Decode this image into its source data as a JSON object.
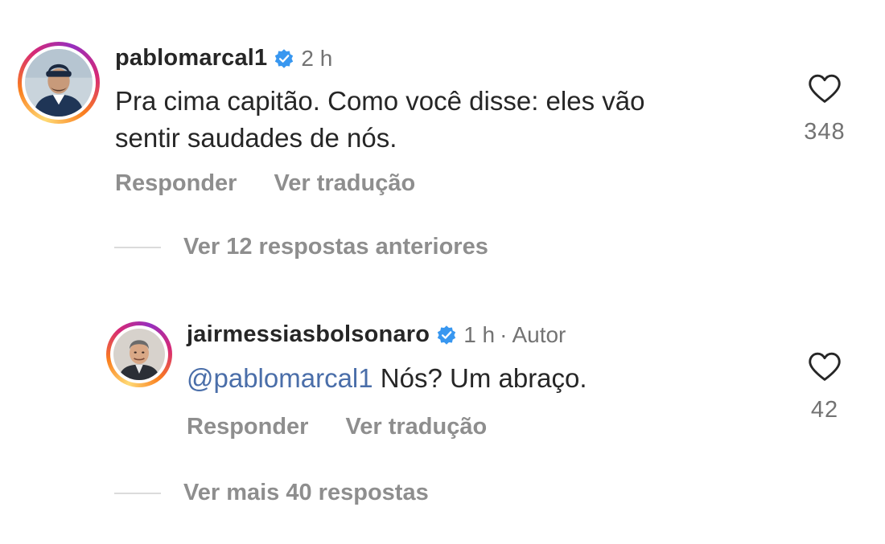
{
  "comments": [
    {
      "username": "pablomarcal1",
      "time": "2 h",
      "text_lines": [
        "Pra cima capitão. Como você disse: eles vão",
        "sentir saudades de nós."
      ],
      "likes": "348",
      "reply_label": "Responder",
      "translate_label": "Ver tradução",
      "verified": true
    },
    {
      "username": "jairmessiasbolsonaro",
      "time": "1 h",
      "separator": "·",
      "author_tag": "Autor",
      "mention": "@pablomarcal1",
      "text": " Nós? Um abraço.",
      "likes": "42",
      "reply_label": "Responder",
      "translate_label": "Ver tradução",
      "verified": true
    }
  ],
  "toggles": {
    "previous_replies": "Ver 12 respostas anteriores",
    "more_replies": "Ver mais 40 respostas"
  },
  "colors": {
    "verified_badge": "#3897f0",
    "mention": "#4a6ea9",
    "secondary_text": "#8e8e8e"
  },
  "icons": {
    "like": "heart-outline-icon",
    "verified": "verified-badge-icon"
  }
}
